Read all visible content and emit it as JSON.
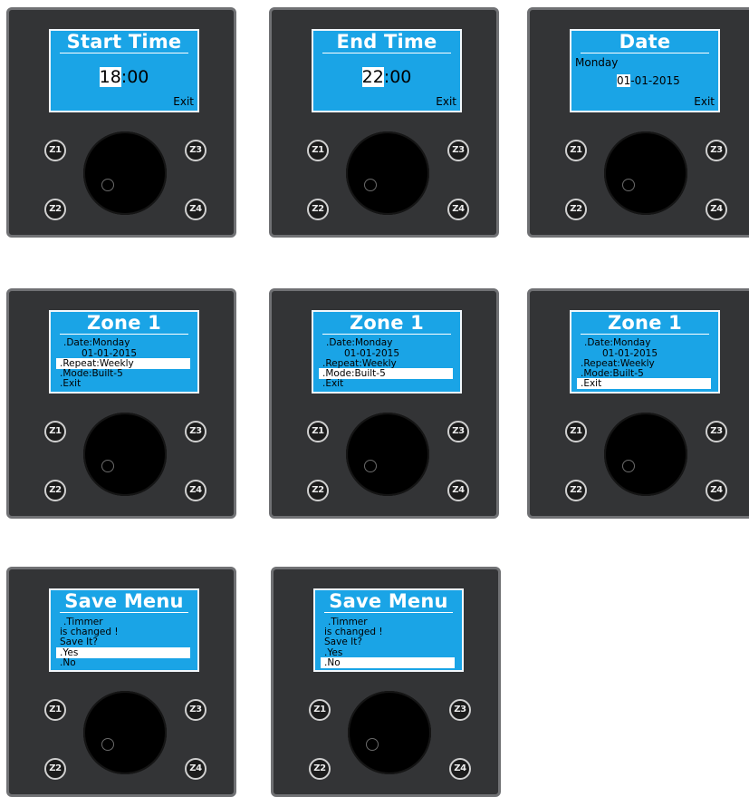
{
  "buttons": {
    "z1": "Z1",
    "z2": "Z2",
    "z3": "Z3",
    "z4": "Z4"
  },
  "colors": {
    "screen": "#1aa4e6",
    "panel": "#333436",
    "panel_border": "#707174",
    "highlight": "#ffffff"
  },
  "panels": {
    "start_time": {
      "title": "Start Time",
      "hours": "18",
      "sep": ":",
      "minutes": "00",
      "exit": "Exit"
    },
    "end_time": {
      "title": "End Time",
      "hours": "22",
      "sep": ":",
      "minutes": "00",
      "exit": "Exit"
    },
    "date": {
      "title": "Date",
      "weekday": "Monday",
      "day": "01",
      "rest": "-01-2015",
      "exit": "Exit"
    },
    "zone_menu": {
      "title": "Zone 1",
      "items": [
        ".Date:Monday",
        "01-01-2015",
        ".Repeat:Weekly",
        ".Mode:Built-5",
        ".Exit"
      ]
    },
    "save_menu": {
      "title": "Save Menu",
      "items": [
        ".Timmer",
        "is changed !",
        "Save It?",
        ".Yes",
        ".No"
      ]
    }
  }
}
